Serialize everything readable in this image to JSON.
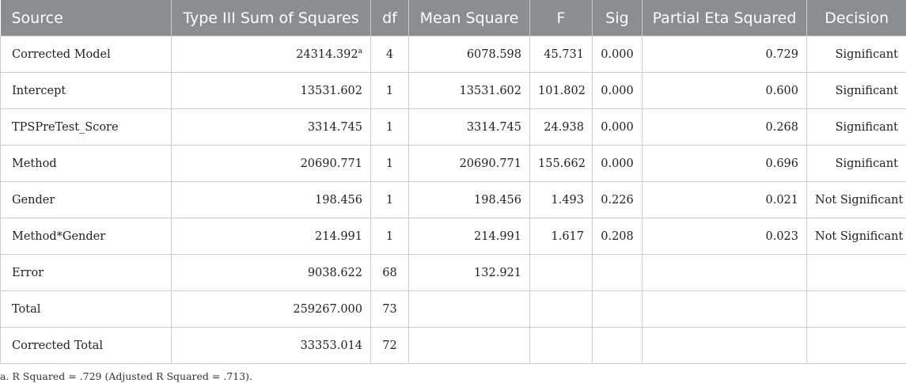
{
  "headers": [
    "Source",
    "Type III Sum of Squares",
    "df",
    "Mean Square",
    "F",
    "Sig",
    "Partial Eta Squared",
    "Decision"
  ],
  "rows": [
    {
      "source": "Corrected Model",
      "ss": "24314.392",
      "ss_sup": "a",
      "df": "4",
      "ms": "6078.598",
      "f": "45.731",
      "sig": "0.000",
      "eta": "0.729",
      "decision": "Significant"
    },
    {
      "source": "Intercept",
      "ss": "13531.602",
      "ss_sup": "",
      "df": "1",
      "ms": "13531.602",
      "f": "101.802",
      "sig": "0.000",
      "eta": "0.600",
      "decision": "Significant"
    },
    {
      "source": "TPSPreTest_Score",
      "ss": "3314.745",
      "ss_sup": "",
      "df": "1",
      "ms": "3314.745",
      "f": "24.938",
      "sig": "0.000",
      "eta": "0.268",
      "decision": "Significant"
    },
    {
      "source": "Method",
      "ss": "20690.771",
      "ss_sup": "",
      "df": "1",
      "ms": "20690.771",
      "f": "155.662",
      "sig": "0.000",
      "eta": "0.696",
      "decision": "Significant"
    },
    {
      "source": "Gender",
      "ss": "198.456",
      "ss_sup": "",
      "df": "1",
      "ms": "198.456",
      "f": "1.493",
      "sig": "0.226",
      "eta": "0.021",
      "decision": "Not Significant"
    },
    {
      "source": "Method*Gender",
      "ss": "214.991",
      "ss_sup": "",
      "df": "1",
      "ms": "214.991",
      "f": "1.617",
      "sig": "0.208",
      "eta": "0.023",
      "decision": "Not Significant"
    },
    {
      "source": "Error",
      "ss": "9038.622",
      "ss_sup": "",
      "df": "68",
      "ms": "132.921",
      "f": "",
      "sig": "",
      "eta": "",
      "decision": ""
    },
    {
      "source": "Total",
      "ss": "259267.000",
      "ss_sup": "",
      "df": "73",
      "ms": "",
      "f": "",
      "sig": "",
      "eta": "",
      "decision": ""
    },
    {
      "source": "Corrected Total",
      "ss": "33353.014",
      "ss_sup": "",
      "df": "72",
      "ms": "",
      "f": "",
      "sig": "",
      "eta": "",
      "decision": ""
    }
  ],
  "footnote": "a. R Squared = .729 (Adjusted R Squared = .713).",
  "colors": {
    "header_bg": "#8a8d91",
    "header_text": "#ffffff",
    "grid": "#c9cbcd"
  }
}
